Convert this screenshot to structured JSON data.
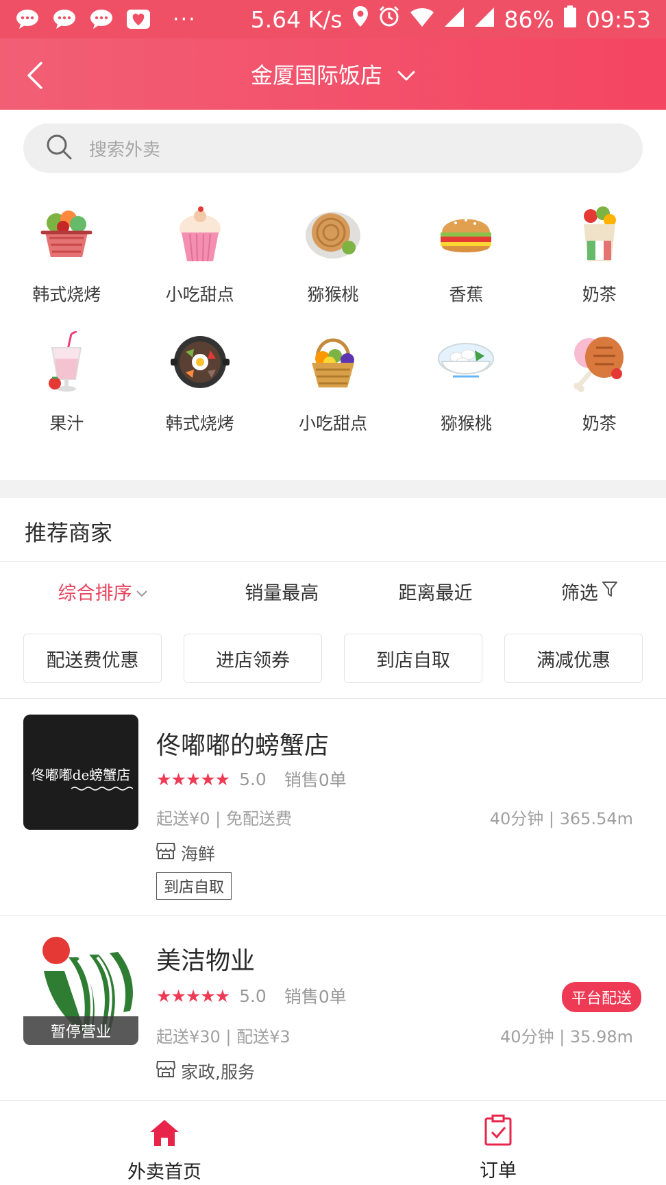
{
  "status_bar": {
    "speed": "5.64 K/s",
    "battery": "86%",
    "time": "09:53",
    "more": "···"
  },
  "header": {
    "title": "金厦国际饭店"
  },
  "search": {
    "placeholder": "搜索外卖"
  },
  "categories": [
    {
      "label": "韩式烧烤",
      "icon": "veg-basket-icon"
    },
    {
      "label": "小吃甜点",
      "icon": "cupcake-icon"
    },
    {
      "label": "猕猴桃",
      "icon": "pancake-icon"
    },
    {
      "label": "香蕉",
      "icon": "burger-icon"
    },
    {
      "label": "奶茶",
      "icon": "wrap-cup-icon"
    },
    {
      "label": "果汁",
      "icon": "smoothie-icon"
    },
    {
      "label": "韩式烧烤",
      "icon": "bibimbap-icon"
    },
    {
      "label": "小吃甜点",
      "icon": "fruit-basket-icon"
    },
    {
      "label": "猕猴桃",
      "icon": "noodle-bowl-icon"
    },
    {
      "label": "奶茶",
      "icon": "drumstick-icon"
    }
  ],
  "section_title": "推荐商家",
  "sorts": [
    "综合排序",
    "销量最高",
    "距离最近",
    "筛选"
  ],
  "chips": [
    "配送费优惠",
    "进店领券",
    "到店自取",
    "满减优惠"
  ],
  "shops": [
    {
      "name": "佟嘟嘟的螃蟹店",
      "logo_text": "佟嘟嘟de螃蟹店",
      "stars": "★★★★★",
      "score": "5.0",
      "sales": "销售0单",
      "min_order": "起送¥0 | 免配送费",
      "eta_distance": "40分钟 | 365.54m",
      "category": "海鲜",
      "badge": "到店自取"
    },
    {
      "name": "美洁物业",
      "stars": "★★★★★",
      "score": "5.0",
      "sales": "销售0单",
      "min_order": "起送¥30 | 配送¥3",
      "eta_distance": "40分钟 | 35.98m",
      "category": "家政,服务",
      "closed_label": "暂停营业",
      "platform_badge": "平台配送"
    }
  ],
  "bottom_nav": [
    {
      "label": "外卖首页",
      "active": true
    },
    {
      "label": "订单",
      "active": false
    }
  ],
  "colors": {
    "accent": "#ee3a55",
    "header": "#f25f75"
  }
}
